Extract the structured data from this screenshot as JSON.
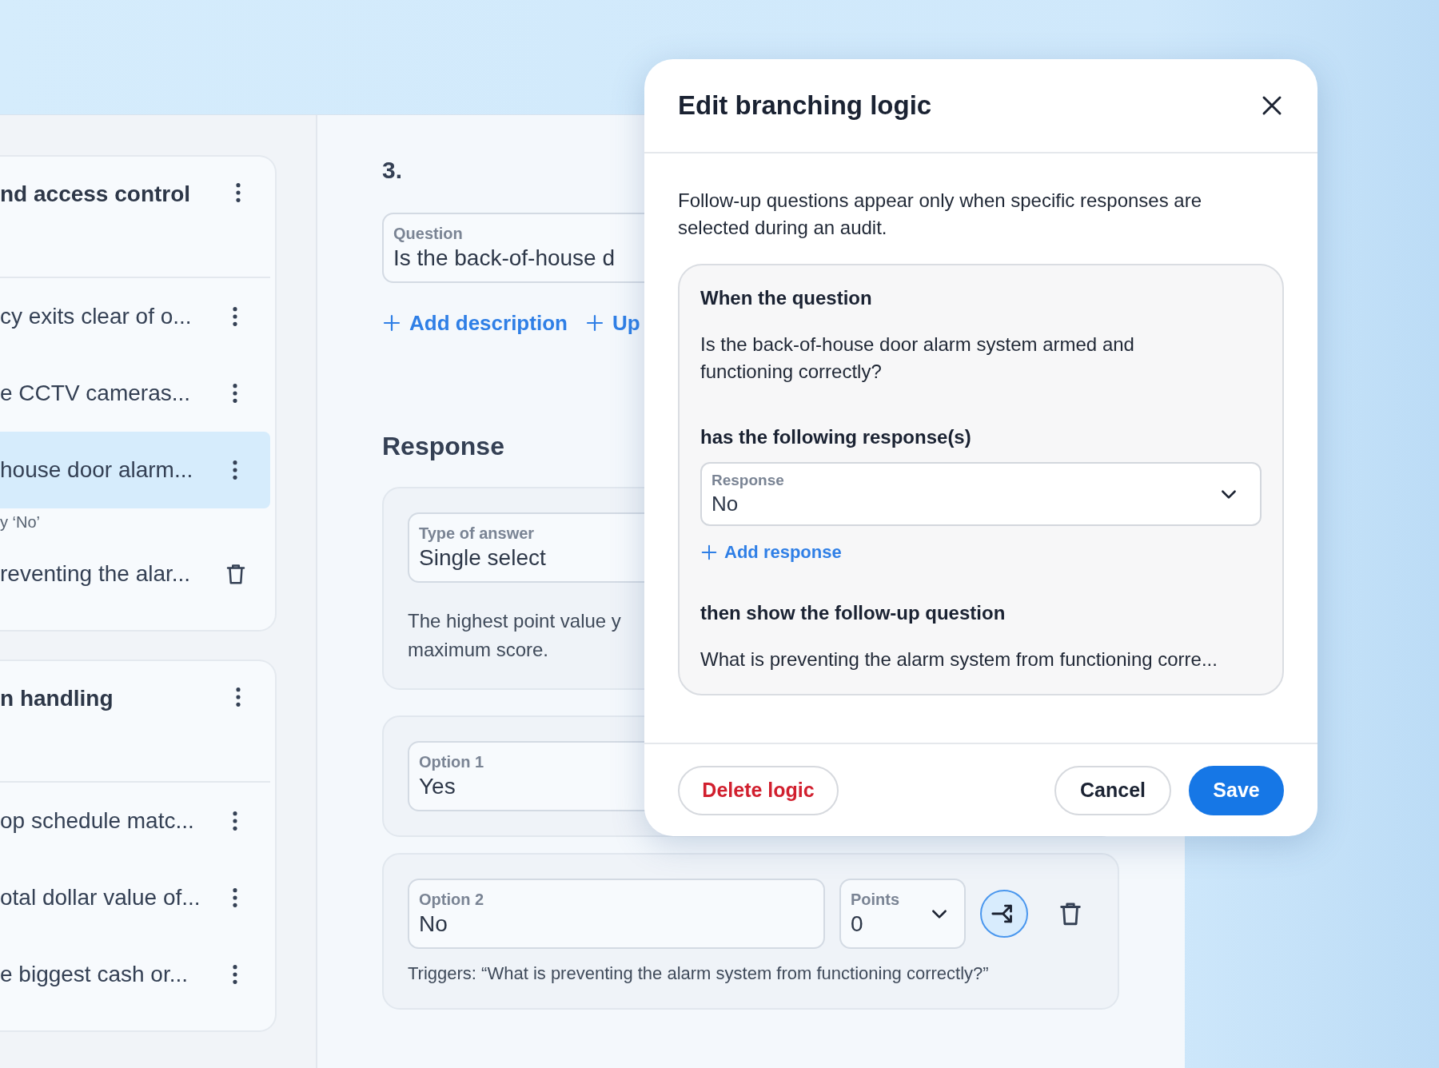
{
  "sidebar": {
    "sections": [
      {
        "title": "nd access control",
        "items": [
          {
            "text": "cy exits clear of o...",
            "selected": false
          },
          {
            "text": "e CCTV cameras...",
            "selected": false
          },
          {
            "text": "house door alarm...",
            "selected": true,
            "children": [
              {
                "condition": "y ‘No’",
                "text": "reventing the alar..."
              }
            ]
          }
        ]
      },
      {
        "title": "n handling",
        "items": [
          {
            "text": "op schedule matc...",
            "selected": false
          },
          {
            "text": "otal dollar value of...",
            "selected": false
          },
          {
            "text": "e biggest cash or...",
            "selected": false
          }
        ]
      }
    ]
  },
  "editor": {
    "number": "3.",
    "question": {
      "label": "Question",
      "value": "Is the back-of-house d"
    },
    "links": [
      "Add description",
      "Up"
    ],
    "response_heading": "Response",
    "answer_type": {
      "label": "Type of answer",
      "value": "Single select"
    },
    "hint_lines": [
      "The highest point value y",
      "maximum score."
    ],
    "options": [
      {
        "label": "Option 1",
        "value": "Yes"
      },
      {
        "label": "Option 2",
        "value": "No",
        "points": {
          "label": "Points",
          "value": "0"
        },
        "branching": true,
        "trigger": "Triggers: “What is preventing the alarm system from functioning correctly?”"
      }
    ]
  },
  "dialog": {
    "title": "Edit branching logic",
    "description": "Follow-up questions appear only when specific responses are selected during an audit.",
    "when_label": "When the question",
    "question": "Is the back-of-house door alarm system armed and functioning correctly?",
    "responses_label": "has the following response(s)",
    "response_select": {
      "label": "Response",
      "value": "No"
    },
    "add_response": "Add response",
    "then_label": "then show the follow-up question",
    "follow_up": "What is preventing the alarm system from functioning corre...",
    "buttons": [
      {
        "label": "Delete logic",
        "kind": "danger"
      },
      {
        "label": "Cancel",
        "kind": "secondary"
      },
      {
        "label": "Save",
        "kind": "primary"
      }
    ]
  }
}
